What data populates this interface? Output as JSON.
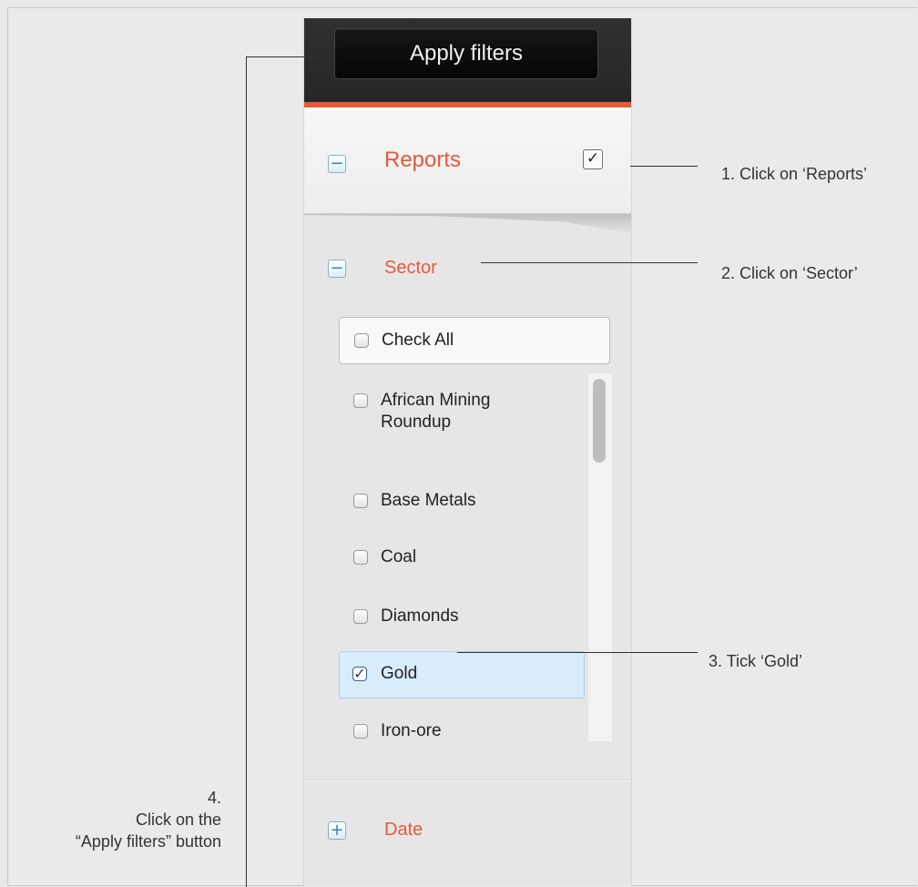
{
  "apply_button": {
    "label": "Apply filters"
  },
  "reports": {
    "label": "Reports",
    "toggle_symbol": "−",
    "checkbox_mark": "✓",
    "checked": true
  },
  "sector": {
    "label": "Sector",
    "toggle_symbol": "−",
    "check_all": "Check All",
    "items": [
      {
        "label": "African Mining Roundup",
        "line1": "African Mining",
        "line2": "Roundup",
        "checked": false
      },
      {
        "label": "Base Metals",
        "checked": false
      },
      {
        "label": "Coal",
        "checked": false
      },
      {
        "label": "Diamonds",
        "checked": false
      },
      {
        "label": "Gold",
        "checked": true,
        "check_mark": "✓"
      },
      {
        "label": "Iron-ore",
        "checked": false
      }
    ]
  },
  "date": {
    "label": "Date",
    "toggle_symbol": "+"
  },
  "callouts": {
    "step1": "1. Click on ‘Reports’",
    "step2": "2. Click on ‘Sector’",
    "step3": "3. Tick ‘Gold’",
    "step4_line1": "4.",
    "step4_line2": "Click on the",
    "step4_line3": "“Apply filters” button"
  },
  "colors": {
    "accent": "#e55a3a",
    "topbar": "#2b2b2b",
    "selected_bg": "#d8ecfb",
    "toggle_border": "#7fb1cf"
  },
  "icons": {
    "collapse": "minus-box-icon",
    "expand": "plus-box-icon",
    "check": "checkmark-icon"
  }
}
